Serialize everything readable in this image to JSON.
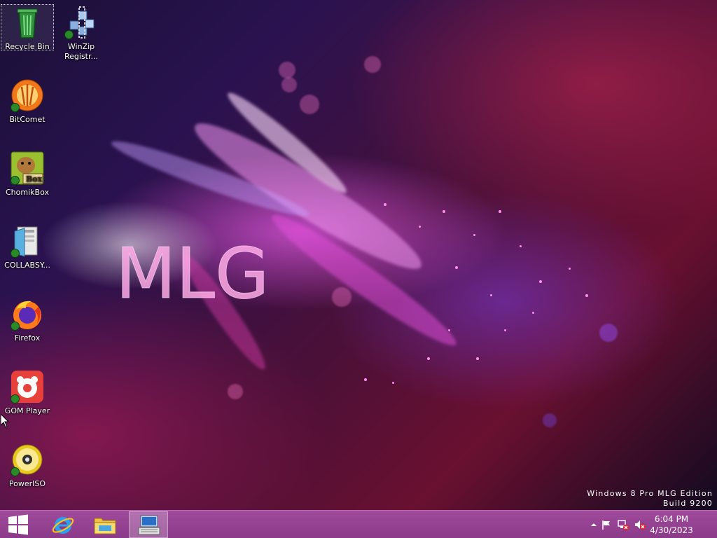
{
  "desktop": {
    "wallpaper_text": "MLG",
    "edition_line1": "Windows 8 Pro MLG Edition",
    "edition_line2": "Build 9200",
    "icons": [
      {
        "label": "Recycle Bin",
        "icon": "recycle-bin-icon",
        "selected": true
      },
      {
        "label": "WinZip Registr...",
        "icon": "winzip-registry-icon"
      },
      {
        "label": "BitComet",
        "icon": "bitcomet-icon"
      },
      {
        "label": "ChomikBox",
        "icon": "chomikbox-icon"
      },
      {
        "label": "COLLABSY...",
        "icon": "collabsys-icon"
      },
      {
        "label": "Firefox",
        "icon": "firefox-icon"
      },
      {
        "label": "GOM Player",
        "icon": "gom-player-icon"
      },
      {
        "label": "PowerISO",
        "icon": "poweriso-icon"
      }
    ]
  },
  "taskbar": {
    "buttons": [
      {
        "name": "start-button",
        "icon": "windows-logo-icon"
      },
      {
        "name": "internet-explorer-button",
        "icon": "internet-explorer-icon"
      },
      {
        "name": "file-explorer-button",
        "icon": "file-explorer-icon"
      },
      {
        "name": "on-screen-keyboard-button",
        "icon": "keyboard-icon",
        "active": true
      }
    ],
    "tray": {
      "icons": [
        "show-hidden-icons-chevron-icon",
        "action-center-flag-icon",
        "network-disconnected-icon",
        "volume-muted-icon"
      ],
      "time": "6:04 PM",
      "date": "4/30/2023"
    }
  },
  "colors": {
    "taskbar": "#953f92",
    "accent_pink": "#e860d8",
    "text": "#ffffff"
  }
}
